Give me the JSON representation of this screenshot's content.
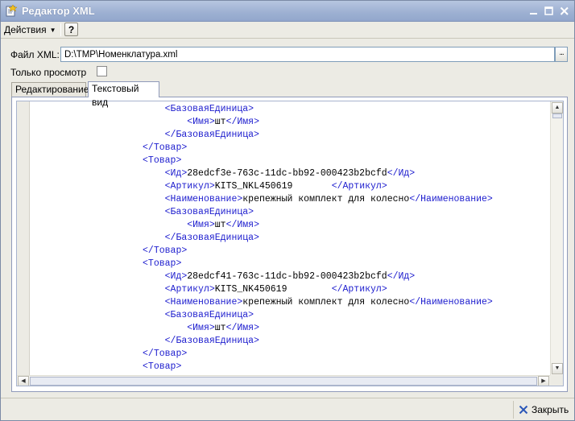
{
  "window": {
    "title": "Редактор XML",
    "icon": "xml-doc-icon"
  },
  "toolbar": {
    "actions_label": "Действия",
    "help_label": "?"
  },
  "form": {
    "file_label": "Файл XML:",
    "file_value": "D:\\TMP\\Номенклатура.xml",
    "file_select_label": "...",
    "readonly_label": "Только просмотр",
    "readonly_checked": false
  },
  "tabs": [
    {
      "label": "Редактирование",
      "active": false
    },
    {
      "label": "Текстовый вид",
      "active": true
    }
  ],
  "editor": {
    "tag_color": "#1C1CCE",
    "lines": [
      {
        "indent": 8,
        "parts": [
          {
            "t": "tag",
            "v": "<БазоваяЕдиница>"
          }
        ]
      },
      {
        "indent": 12,
        "parts": [
          {
            "t": "tag",
            "v": "<Имя>"
          },
          {
            "t": "txt",
            "v": "шт"
          },
          {
            "t": "tag",
            "v": "</Имя>"
          }
        ]
      },
      {
        "indent": 8,
        "parts": [
          {
            "t": "tag",
            "v": "</БазоваяЕдиница>"
          }
        ]
      },
      {
        "indent": 4,
        "parts": [
          {
            "t": "tag",
            "v": "</Товар>"
          }
        ]
      },
      {
        "indent": 4,
        "parts": [
          {
            "t": "tag",
            "v": "<Товар>"
          }
        ]
      },
      {
        "indent": 8,
        "parts": [
          {
            "t": "tag",
            "v": "<Ид>"
          },
          {
            "t": "txt",
            "v": "28edcf3e-763c-11dc-bb92-000423b2bcfd"
          },
          {
            "t": "tag",
            "v": "</Ид>"
          }
        ]
      },
      {
        "indent": 8,
        "parts": [
          {
            "t": "tag",
            "v": "<Артикул>"
          },
          {
            "t": "txt",
            "v": "KITS_NKL450619       "
          },
          {
            "t": "tag",
            "v": "</Артикул>"
          }
        ]
      },
      {
        "indent": 8,
        "parts": [
          {
            "t": "tag",
            "v": "<Наименование>"
          },
          {
            "t": "txt",
            "v": "крепежный комплект для колесно"
          },
          {
            "t": "tag",
            "v": "</Наименование>"
          }
        ]
      },
      {
        "indent": 8,
        "parts": [
          {
            "t": "tag",
            "v": "<БазоваяЕдиница>"
          }
        ]
      },
      {
        "indent": 12,
        "parts": [
          {
            "t": "tag",
            "v": "<Имя>"
          },
          {
            "t": "txt",
            "v": "шт"
          },
          {
            "t": "tag",
            "v": "</Имя>"
          }
        ]
      },
      {
        "indent": 8,
        "parts": [
          {
            "t": "tag",
            "v": "</БазоваяЕдиница>"
          }
        ]
      },
      {
        "indent": 4,
        "parts": [
          {
            "t": "tag",
            "v": "</Товар>"
          }
        ]
      },
      {
        "indent": 4,
        "parts": [
          {
            "t": "tag",
            "v": "<Товар>"
          }
        ]
      },
      {
        "indent": 8,
        "parts": [
          {
            "t": "tag",
            "v": "<Ид>"
          },
          {
            "t": "txt",
            "v": "28edcf41-763c-11dc-bb92-000423b2bcfd"
          },
          {
            "t": "tag",
            "v": "</Ид>"
          }
        ]
      },
      {
        "indent": 8,
        "parts": [
          {
            "t": "tag",
            "v": "<Артикул>"
          },
          {
            "t": "txt",
            "v": "KITS_NK450619        "
          },
          {
            "t": "tag",
            "v": "</Артикул>"
          }
        ]
      },
      {
        "indent": 8,
        "parts": [
          {
            "t": "tag",
            "v": "<Наименование>"
          },
          {
            "t": "txt",
            "v": "крепежный комплект для колесно"
          },
          {
            "t": "tag",
            "v": "</Наименование>"
          }
        ]
      },
      {
        "indent": 8,
        "parts": [
          {
            "t": "tag",
            "v": "<БазоваяЕдиница>"
          }
        ]
      },
      {
        "indent": 12,
        "parts": [
          {
            "t": "tag",
            "v": "<Имя>"
          },
          {
            "t": "txt",
            "v": "шт"
          },
          {
            "t": "tag",
            "v": "</Имя>"
          }
        ]
      },
      {
        "indent": 8,
        "parts": [
          {
            "t": "tag",
            "v": "</БазоваяЕдиница>"
          }
        ]
      },
      {
        "indent": 4,
        "parts": [
          {
            "t": "tag",
            "v": "</Товар>"
          }
        ]
      },
      {
        "indent": 4,
        "parts": [
          {
            "t": "tag",
            "v": "<Товар>"
          }
        ]
      }
    ]
  },
  "footer": {
    "close_label": "Закрыть",
    "close_icon": "close-x-icon"
  },
  "colors": {
    "tag": "#1C1CCE",
    "titlebar": "#9DB0D2",
    "window_bg": "#ECEBE4"
  }
}
